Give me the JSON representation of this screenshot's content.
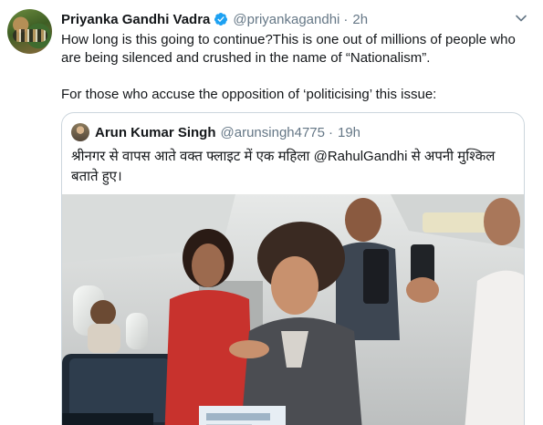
{
  "tweet": {
    "author_name": "Priyanka Gandhi Vadra",
    "handle": "@priyankagandhi",
    "separator": "·",
    "time": "2h",
    "text_paragraph_1": "How long is this going to continue?This is one out of millions of people who are being silenced and crushed in the name of “Nationalism”.",
    "text_paragraph_2": "For those who accuse the opposition of ‘politicising’ this issue:",
    "verified": true,
    "verified_color": "#1da1f2"
  },
  "quoted_tweet": {
    "author_name": "Arun Kumar Singh",
    "handle": "@arunsingh4775",
    "separator": "·",
    "time": "19h",
    "text": "श्रीनगर से वापस आते वक्त फ्लाइट में एक महिला @RahulGandhi से अपनी मुश्किल बताते हुए।"
  },
  "icons": {
    "verified": "verified-badge-icon",
    "menu": "chevron-down-icon"
  },
  "colors": {
    "text_primary": "#14171a",
    "text_secondary": "#657786",
    "border": "#ccd6dd"
  }
}
